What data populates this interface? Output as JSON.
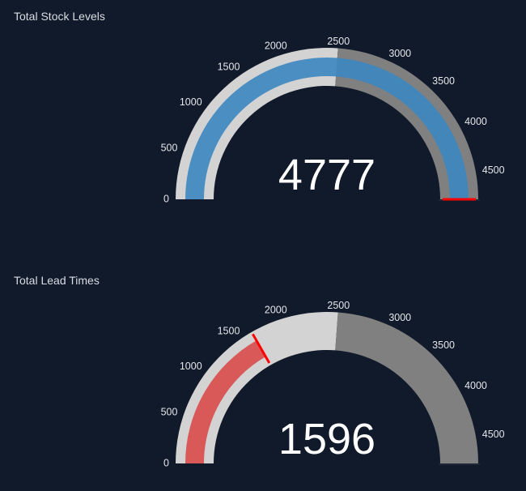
{
  "gauges": [
    {
      "title": "Total Stock Levels",
      "value_text": "4777"
    },
    {
      "title": "Total Lead Times",
      "value_text": "1596"
    }
  ],
  "chart_data": [
    {
      "type": "gauge",
      "title": "Total Stock Levels",
      "value": 4777,
      "range": [
        0,
        4777
      ],
      "ticks": [
        0,
        500,
        1000,
        1500,
        2000,
        2500,
        3000,
        3500,
        4000,
        4500
      ],
      "steps": [
        {
          "range": [
            0,
            2500
          ],
          "color": "#d3d3d3"
        },
        {
          "range": [
            2500,
            4777
          ],
          "color": "#808080"
        }
      ],
      "threshold": 4777,
      "bar_color": "#3c86c0",
      "threshold_color": "#ff0000"
    },
    {
      "type": "gauge",
      "title": "Total Lead Times",
      "value": 1596,
      "range": [
        0,
        4777
      ],
      "ticks": [
        0,
        500,
        1000,
        1500,
        2000,
        2500,
        3000,
        3500,
        4000,
        4500
      ],
      "steps": [
        {
          "range": [
            0,
            2500
          ],
          "color": "#d3d3d3"
        },
        {
          "range": [
            2500,
            4777
          ],
          "color": "#808080"
        }
      ],
      "threshold": 1596,
      "bar_color": "#d94a4a",
      "threshold_color": "#ff0000"
    }
  ]
}
